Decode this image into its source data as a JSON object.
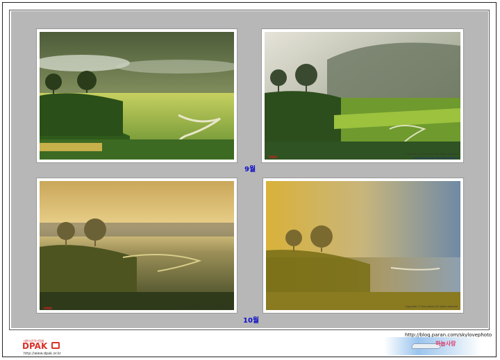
{
  "captions": {
    "september": "9월",
    "october": "10월"
  },
  "photo_credit": "Copyright ⓒ ilove photo All rights reserved",
  "photo_url": "http://blog.paran.com/skylovephoto",
  "mini_logo": "DPAK",
  "footer": {
    "logo_top": "대한사진작가협회",
    "logo_text": "DPAK",
    "logo_url": "http://www.dpak.or.kr",
    "blog_url": "http://blog.paran.com/skylovephoto",
    "blog_logo": "하늘사랑"
  },
  "colors": {
    "caption": "#1010c8",
    "panel": "#b7b7b7",
    "logo_red": "#d8322a"
  }
}
